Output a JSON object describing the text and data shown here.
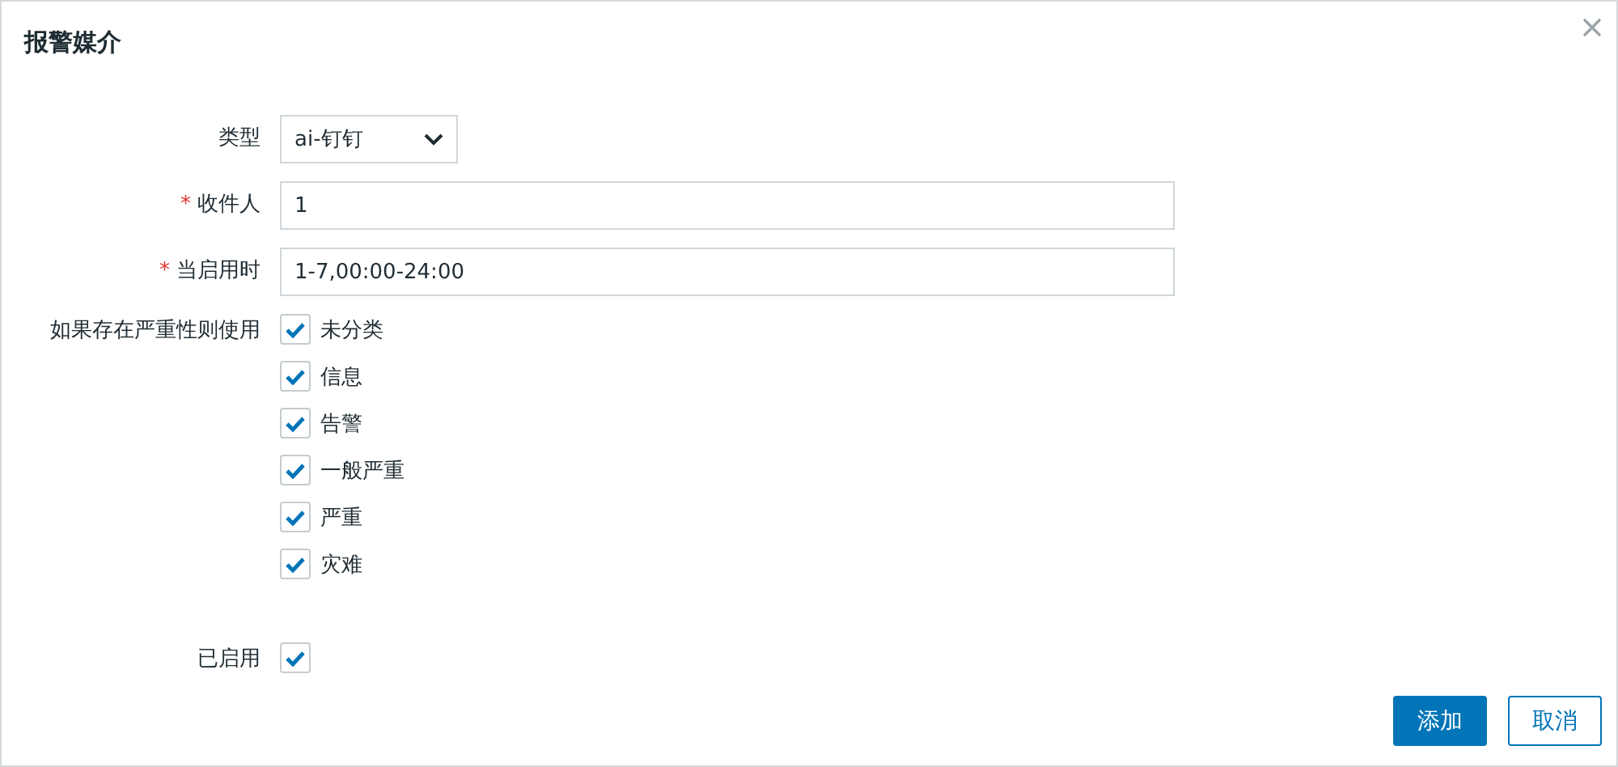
{
  "dialog": {
    "title": "报警媒介"
  },
  "fields": [
    {
      "kind": "select",
      "label": "类型",
      "value": "ai-钉钉"
    },
    {
      "kind": "input",
      "label": "收件人",
      "required_mark": "*",
      "value": "1"
    },
    {
      "kind": "input",
      "label": "当启用时",
      "required_mark": "*",
      "value": "1-7,00:00-24:00"
    },
    {
      "kind": "checklist",
      "label": "如果存在严重性则使用",
      "options": [
        {
          "label": "未分类",
          "checked": true
        },
        {
          "label": "信息",
          "checked": true
        },
        {
          "label": "告警",
          "checked": true
        },
        {
          "label": "一般严重",
          "checked": true
        },
        {
          "label": "严重",
          "checked": true
        },
        {
          "label": "灾难",
          "checked": true
        }
      ]
    },
    {
      "kind": "checkbox",
      "label": "已启用",
      "checked": true
    }
  ],
  "buttons": [
    {
      "label": "添加",
      "primary": true
    },
    {
      "label": "取消",
      "primary": false
    }
  ]
}
